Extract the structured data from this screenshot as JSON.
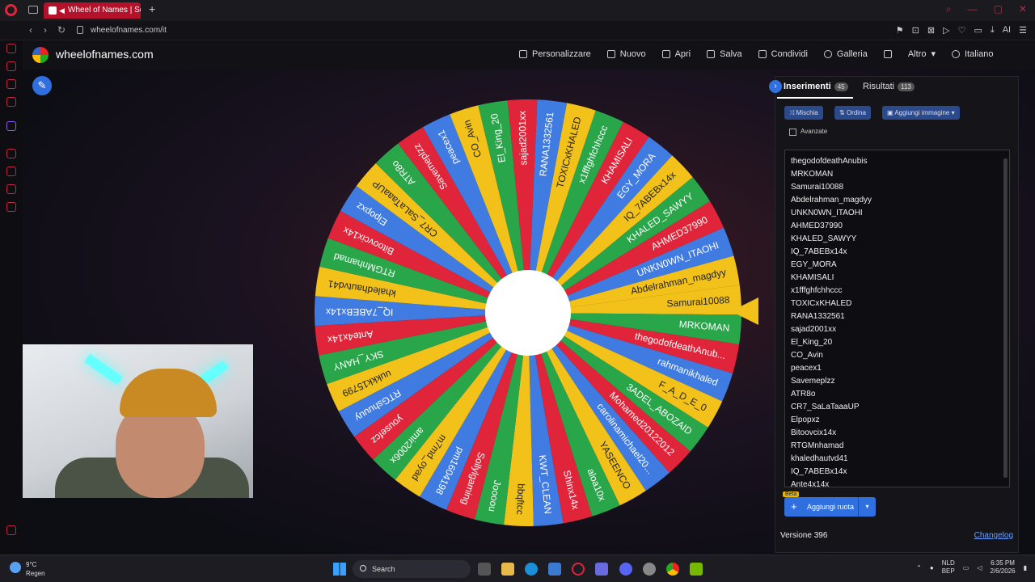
{
  "browser": {
    "tab_title": "Wheel of Names | Scel",
    "new_tab": "+",
    "url": "wheelofnames.com/it",
    "addr_ai": "AI"
  },
  "site": {
    "name": "wheelofnames.com",
    "menu": [
      "Personalizzare",
      "Nuovo",
      "Apri",
      "Salva",
      "Condividi",
      "Galleria",
      "Altro",
      "Italiano"
    ]
  },
  "wheel": {
    "colors": [
      "#f2c21a",
      "#2aa64a",
      "#e0253a",
      "#3f7be0"
    ],
    "segments": [
      "Samurai10088",
      "MRKOMAN",
      "thegodofdeathAnub...",
      "rahmanikhaled",
      "F_A_D_E_0",
      "3ADEL_ABOZAID",
      "Mohamed20122012",
      "carolinamichael20...",
      "YASEENCO",
      "aloa10x",
      "Shinx14x",
      "KWT_CLEAN",
      "bbqftcc",
      "Joooou",
      "Sollylgaming",
      "pm1604198",
      "m7md_oyad",
      "amir2006x",
      "yousefcz",
      "RTGshuuuy",
      "uukkk15799",
      "SKY_HANY",
      "Ante4x14x",
      "IQ_7ABEBx14x",
      "khaledhautvd41",
      "RTGMnhamad",
      "Bitoovcix14x",
      "Elpopxz",
      "CR7_SaLaTaaaUP",
      "ATR8o",
      "Savemeplzz",
      "peacex1",
      "CO_Avin",
      "El_King_20",
      "sajad2001xx",
      "RANA1332561",
      "TOXICxKHALED",
      "x1fffghfchhccc",
      "KHAMISALI",
      "EGY_MORA",
      "IQ_7ABEBx14x",
      "KHALED_SAWYY",
      "AHMED37990",
      "UNKN0WN_ITAOHI",
      "Abdelrahman_magdyy"
    ]
  },
  "panel": {
    "tab_entries": "Inserimenti",
    "entries_count": "45",
    "tab_results": "Risultati",
    "results_count": "113",
    "shuffle": "Mischia",
    "sort": "Ordina",
    "add_image": "Aggiungi immagine",
    "advanced": "Avanzate",
    "entries": [
      "thegodofdeathAnubis",
      "MRKOMAN",
      "Samurai10088",
      "Abdelrahman_magdyy",
      "UNKN0WN_ITAOHI",
      "AHMED37990",
      "KHALED_SAWYY",
      "IQ_7ABEBx14x",
      "EGY_MORA",
      "KHAMISALI",
      "x1fffghfchhccc",
      "TOXICxKHALED",
      "RANA1332561",
      "sajad2001xx",
      "El_King_20",
      "CO_Avin",
      "peacex1",
      "Savemeplzz",
      "ATR8o",
      "CR7_SaLaTaaaUP",
      "Elpopxz",
      "Bitoovcix14x",
      "RTGMnhamad",
      "khaledhautvd41",
      "IQ_7ABEBx14x",
      "Ante4x14x"
    ],
    "beta": "Beta",
    "add_wheel": "Aggiungi ruota",
    "version": "Versione 396",
    "changelog": "Changelog"
  },
  "taskbar": {
    "weather_temp": "9°C",
    "weather_desc": "Regen",
    "search": "Search",
    "lang_top": "NLD",
    "lang_bottom": "BEP",
    "time": "6:35 PM",
    "date": "2/6/2026"
  }
}
